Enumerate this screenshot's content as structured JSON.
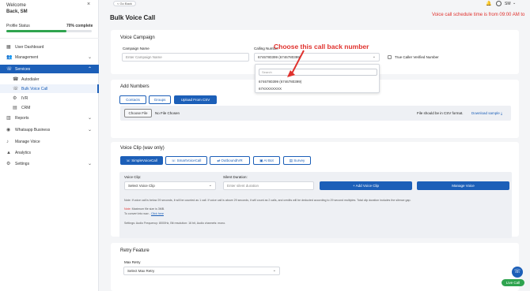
{
  "sidebar": {
    "welcome_line1": "Welcome",
    "welcome_line2": "Back, SM",
    "close_label": "×",
    "profile_status_label": "Profile Status",
    "profile_complete_label": "70% complete",
    "profile_progress": 0.7,
    "items": [
      {
        "label": "User Dashboard",
        "icon": "dashboard-icon",
        "glyph": "▦"
      },
      {
        "label": "Management",
        "icon": "management-icon",
        "glyph": "👥"
      },
      {
        "label": "Services",
        "icon": "services-icon",
        "glyph": "☏"
      },
      {
        "label": "Autodialer",
        "icon": "autodialer-icon",
        "glyph": "☎"
      },
      {
        "label": "Bulk Voice Call",
        "icon": "bulk-voice-icon",
        "glyph": "☏"
      },
      {
        "label": "IVR",
        "icon": "ivr-icon",
        "glyph": "⚙"
      },
      {
        "label": "CRM",
        "icon": "crm-icon",
        "glyph": "▤"
      },
      {
        "label": "Reports",
        "icon": "reports-icon",
        "glyph": "▥"
      },
      {
        "label": "Whatsapp Business",
        "icon": "whatsapp-icon",
        "glyph": "◉"
      },
      {
        "label": "Manage Voice",
        "icon": "microphone-icon",
        "glyph": "♪"
      },
      {
        "label": "Analytics",
        "icon": "analytics-icon",
        "glyph": "▲"
      },
      {
        "label": "Settings",
        "icon": "settings-icon",
        "glyph": "⚙"
      }
    ]
  },
  "header": {
    "go_back_label": "< Go Back",
    "title": "Bulk Voice Call",
    "schedule_note": "Voice call schedule time is from 09:00 AM to",
    "user_initials": "SM"
  },
  "voice_campaign": {
    "title": "Voice Campaign",
    "campaign_name_label": "Campaign Name",
    "campaign_name_placeholder": "Enter Campaign Name",
    "calling_number_label": "Calling Number",
    "calling_number_value": "6746780399 (6746780399)",
    "true_caller_label": "True Caller Verified Number",
    "dropdown": {
      "search_placeholder": "Search",
      "options": [
        "6746780399 (6746780399)",
        "67XXXXXXXX"
      ]
    },
    "annotation": "Choose this call back number"
  },
  "add_numbers": {
    "title": "Add Numbers",
    "tabs": [
      "Contacts",
      "Groups",
      "Upload From CSV"
    ],
    "choose_file_label": "Choose File",
    "no_file_label": "No File Chosen",
    "csv_note": "File should be in CSV format.",
    "download_sample_label": "Download sample ⤓"
  },
  "voice_clip": {
    "title": "Voice Clip (wav only)",
    "tabs": [
      "SimpleVoiceCall",
      "SmartVoiceCall",
      "OutboundIVR",
      "AI Bot",
      "Survey"
    ],
    "voice_clip_label": "Voice Clip:",
    "voice_clip_select": "Select Voice Clip",
    "silent_duration_label": "Silent Duration:",
    "silent_duration_placeholder": "Enter silent duration",
    "add_voice_clip_label": "+ Add Voice Clip",
    "manage_voice_label": "Manage Voice",
    "note1": "Note: If voice call is below 29 seconds, it will be counted as 1 call. If voice call is above 29 seconds, it will count as 2 calls, and credits will be deducted according to 29 second multiples. Total clip duration includes the silence gap.",
    "note2_prefix": "Note:",
    "note2_text": " Maximum file size is 3MB.",
    "note3_text": "To convert into wav - ",
    "note3_link": "Click here",
    "settings_note": "Settings: Audio Frequency: 8000Hz, Bit resolution: 16 bit, Audio channels: mono."
  },
  "retry": {
    "title": "Retry Feature",
    "max_retry_label": "Max Retry",
    "max_retry_select": "Select Max Retry"
  },
  "live_chat_label": "Live Call",
  "colors": {
    "primary": "#1c5fb8",
    "progress": "#2fa44f",
    "alert": "#e0312d"
  }
}
